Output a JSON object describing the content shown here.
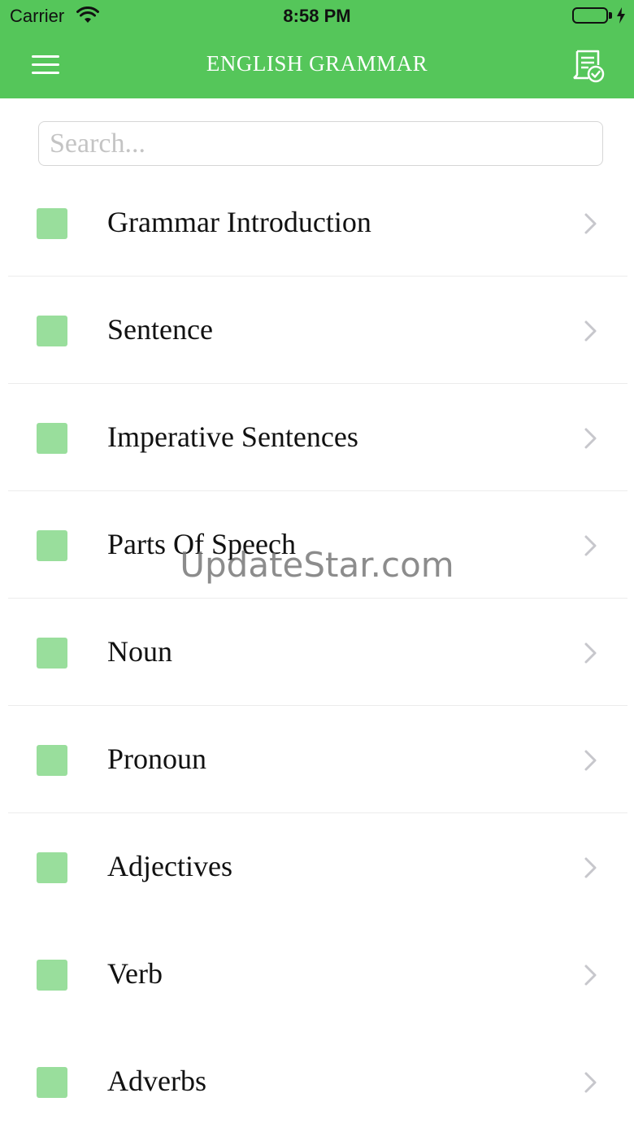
{
  "status_bar": {
    "carrier": "Carrier",
    "time": "8:58 PM",
    "wifi_icon": "wifi-icon",
    "battery_icon": "battery-icon",
    "charging_icon": "bolt-icon",
    "battery_level": 1.0
  },
  "header": {
    "title": "ENGLISH GRAMMAR",
    "menu_icon": "hamburger-menu-icon",
    "action_icon": "quiz-check-icon",
    "color": "#55c65a"
  },
  "search": {
    "placeholder": "Search...",
    "value": ""
  },
  "topics": [
    {
      "label": "Grammar Introduction"
    },
    {
      "label": "Sentence"
    },
    {
      "label": "Imperative Sentences"
    },
    {
      "label": "Parts Of Speech"
    },
    {
      "label": "Noun"
    },
    {
      "label": "Pronoun"
    },
    {
      "label": "Adjectives"
    },
    {
      "label": "Verb"
    },
    {
      "label": "Adverbs"
    }
  ],
  "topic_marker_color": "#99de9c",
  "watermark": "UpdateStar.com"
}
